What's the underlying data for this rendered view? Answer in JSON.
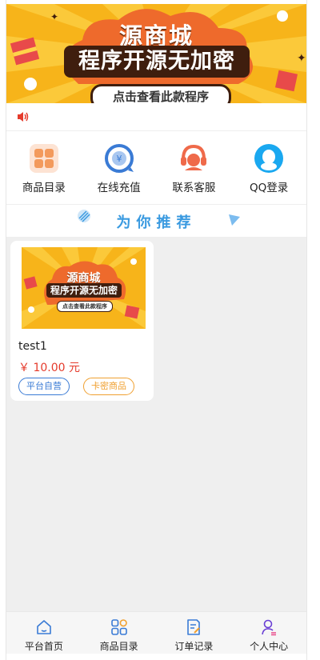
{
  "banner": {
    "title": "源商城",
    "headline": "程序开源无加密",
    "button_label": "点击查看此款程序"
  },
  "quick_nav": [
    {
      "label": "商品目录",
      "icon": "grid-icon"
    },
    {
      "label": "在线充值",
      "icon": "yuan-coin-icon"
    },
    {
      "label": "联系客服",
      "icon": "headset-icon"
    },
    {
      "label": "QQ登录",
      "icon": "qq-penguin-icon"
    }
  ],
  "recommend": {
    "title": "为你推荐"
  },
  "products": [
    {
      "name": "test1",
      "price": "￥ 10.00 元",
      "tags": [
        "平台自营",
        "卡密商品"
      ],
      "thumb": {
        "title": "源商城",
        "headline": "程序开源无加密",
        "button_label": "点击查看此款程序"
      }
    }
  ],
  "tabbar": [
    {
      "label": "平台首页",
      "icon": "home-icon"
    },
    {
      "label": "商品目录",
      "icon": "category-icon"
    },
    {
      "label": "订单记录",
      "icon": "order-icon"
    },
    {
      "label": "个人中心",
      "icon": "user-icon"
    }
  ],
  "colors": {
    "banner_bg": "#f7b41a",
    "accent_blue": "#3a9ae0",
    "price_red": "#e53b2c",
    "tag_blue": "#3a7bd5",
    "tag_orange": "#f0a030",
    "content_bg": "#efefef"
  }
}
